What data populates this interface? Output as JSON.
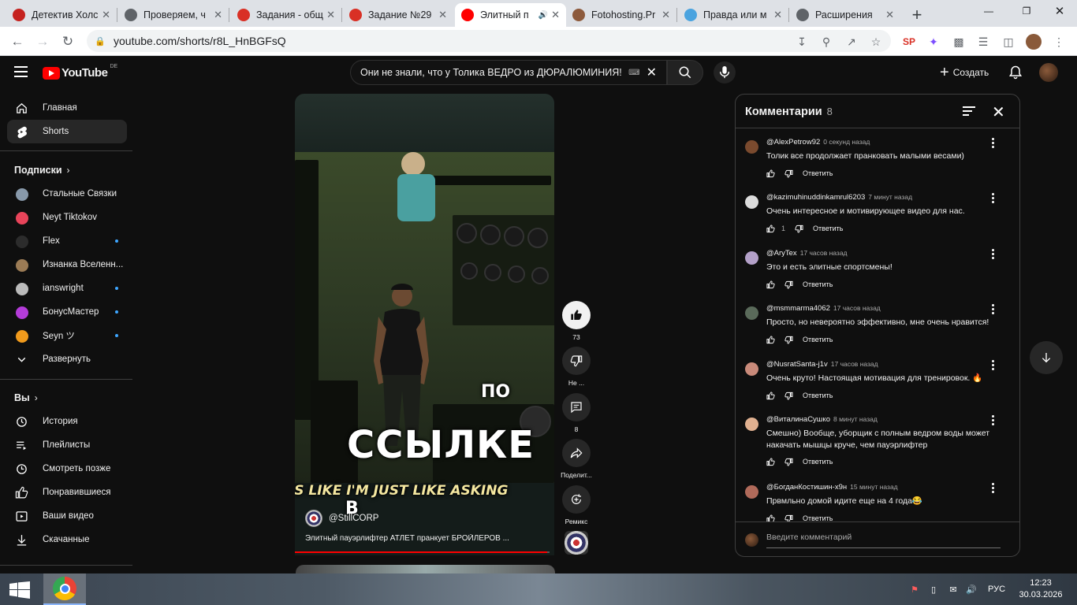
{
  "browser": {
    "tabs": [
      {
        "title": "Детектив Холс",
        "color": "#c5221f"
      },
      {
        "title": "Проверяем, ч",
        "color": "#5f6368"
      },
      {
        "title": "Задания - общ",
        "color": "#d93025"
      },
      {
        "title": "Задание №29",
        "color": "#d93025"
      },
      {
        "title": "Элитный п",
        "color": "#ff0000"
      },
      {
        "title": "Fotohosting.Pr",
        "color": "#8d5a3c"
      },
      {
        "title": "Правда или м",
        "color": "#4aa3df"
      },
      {
        "title": "Расширения",
        "color": "#5f6368"
      }
    ],
    "url": "youtube.com/shorts/r8L_HnBGFsQ"
  },
  "youtube": {
    "logo_text": "YouTube",
    "country": "DE",
    "search_query": "Они не знали, что у Толика ВЕДРО из ДЮРАЛЮМИНИЯ!",
    "keyboard_glyph": "⌨",
    "create_label": "Создать"
  },
  "sidebar": {
    "main": [
      {
        "label": "Главная",
        "icon": "home-icon"
      },
      {
        "label": "Shorts",
        "icon": "shorts-icon"
      }
    ],
    "subs_title": "Подписки",
    "subs": [
      {
        "label": "Стальные Связки",
        "color": "#8899aa",
        "dot": false
      },
      {
        "label": "Neyt Tiktokov",
        "color": "#e8445a",
        "dot": false
      },
      {
        "label": "Flex",
        "color": "#2c2c2c",
        "dot": true
      },
      {
        "label": "Изнанка Вселенн...",
        "color": "#9b7b55",
        "dot": false
      },
      {
        "label": "ianswright",
        "color": "#bbbbbb",
        "dot": true
      },
      {
        "label": "БонусМастер",
        "color": "#b43cd9",
        "dot": true
      },
      {
        "label": "Seyn ツ",
        "color": "#f09a1c",
        "dot": true
      }
    ],
    "expand_label": "Развернуть",
    "you_title": "Вы",
    "you": [
      {
        "label": "История",
        "icon": "history-icon"
      },
      {
        "label": "Плейлисты",
        "icon": "playlists-icon"
      },
      {
        "label": "Смотреть позже",
        "icon": "watch-later-icon"
      },
      {
        "label": "Понравившиеся",
        "icon": "liked-icon"
      },
      {
        "label": "Ваши видео",
        "icon": "your-videos-icon"
      },
      {
        "label": "Скачанные",
        "icon": "downloads-icon"
      }
    ]
  },
  "short": {
    "caption_1": "ПО",
    "caption_2": "ССЫЛКЕ",
    "caption_3": "'S LIKE I'M JUST LIKE ASKING",
    "caption_4": "В",
    "channel": "@StillCORP",
    "description": "Элитный пауэрлифтер АТЛЕТ пранкует БРОЙЛЕРОВ ...",
    "progress": 0.99,
    "likes": "73",
    "dislike_label": "Не ...",
    "comments_count": "8",
    "share_label": "Поделит...",
    "remix_label": "Ремикс"
  },
  "comments": {
    "title": "Комментарии",
    "count": "8",
    "reply_label": "Ответить",
    "input_placeholder": "Введите комментарий",
    "items": [
      {
        "author": "@AlexPetrow92",
        "time": "0 секунд назад",
        "text": "Толик все продолжает пранковать малыми весами)",
        "likes": "",
        "avatar": "#7a4a2e"
      },
      {
        "author": "@kazimuhinuddinkamrul6203",
        "time": "7 минут назад",
        "text": "Очень интересное и мотивирующее видео для нас.",
        "likes": "1",
        "avatar": "#dcdcdc"
      },
      {
        "author": "@AryTex",
        "time": "17 часов назад",
        "text": "Это и есть элитные спортсмены!",
        "likes": "",
        "avatar": "#b3a0c8"
      },
      {
        "author": "@msmmarma4062",
        "time": "17 часов назад",
        "text": "Просто, но невероятно эффективно, мне очень нравится!",
        "likes": "",
        "avatar": "#5a6a5a"
      },
      {
        "author": "@NusratSanta-j1v",
        "time": "17 часов назад",
        "text": "Очень круто! Настоящая мотивация для тренировок. 🔥",
        "likes": "",
        "avatar": "#c98a7a"
      },
      {
        "author": "@ВиталинаСушко",
        "time": "8 минут назад",
        "text": "Смешно) Вообще, уборщик с полным ведром воды может накачать мышцы круче, чем пауэрлифтер",
        "likes": "",
        "avatar": "#e0b090"
      },
      {
        "author": "@БогданКостишин-х9н",
        "time": "15 минут назад",
        "text": "Првмльно домой идите еще на 4 года😂",
        "likes": "",
        "avatar": "#b06a5a"
      }
    ]
  },
  "taskbar": {
    "lang": "РУС",
    "time": "12:23",
    "date": "30.03.2026"
  }
}
